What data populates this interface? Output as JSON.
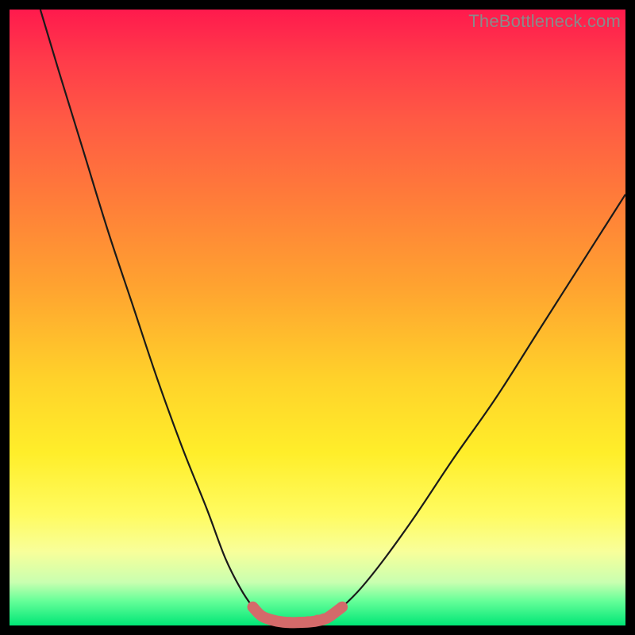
{
  "watermark": "TheBottleneck.com",
  "colors": {
    "curve_stroke": "#1a1a1a",
    "valley_stroke": "#d46a6a",
    "valley_fill": "#d46a6a"
  },
  "chart_data": {
    "type": "line",
    "title": "",
    "xlabel": "",
    "ylabel": "",
    "xlim": [
      0,
      100
    ],
    "ylim": [
      0,
      100
    ],
    "series": [
      {
        "name": "left-curve",
        "x": [
          5,
          8,
          12,
          16,
          20,
          24,
          28,
          32,
          35,
          37.5,
          39.5,
          41
        ],
        "y": [
          100,
          90,
          77,
          64,
          52,
          40,
          29,
          19,
          11,
          6,
          3,
          1.5
        ]
      },
      {
        "name": "right-curve",
        "x": [
          52,
          54,
          57,
          61,
          66,
          72,
          79,
          86,
          93,
          100
        ],
        "y": [
          1.5,
          3,
          6,
          11,
          18,
          27,
          37,
          48,
          59,
          70
        ]
      },
      {
        "name": "valley-floor",
        "x": [
          41,
          43,
          45,
          47,
          49,
          51,
          52
        ],
        "y": [
          1.5,
          0.8,
          0.5,
          0.5,
          0.6,
          1.0,
          1.5
        ]
      }
    ],
    "valley_markers": {
      "name": "valley-markers",
      "x": [
        39.5,
        41,
        42.5,
        44,
        45.5,
        47,
        48.5,
        50,
        51,
        52,
        53
      ],
      "y": [
        3,
        1.5,
        0.9,
        0.6,
        0.5,
        0.5,
        0.6,
        0.9,
        1.2,
        1.5,
        2.2
      ],
      "r": [
        5,
        6,
        6,
        6.5,
        7,
        7,
        7,
        6.5,
        6,
        6,
        5
      ]
    }
  }
}
